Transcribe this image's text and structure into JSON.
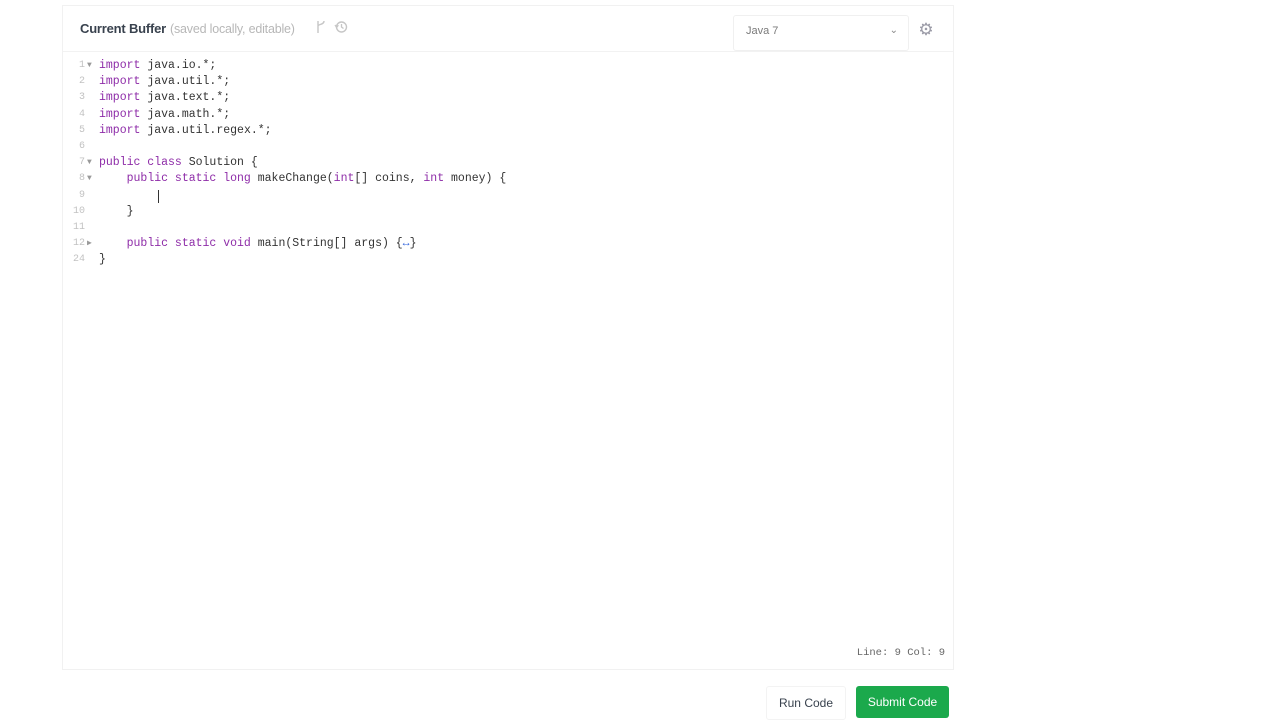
{
  "header": {
    "title": "Current Buffer",
    "subtitle": "(saved locally, editable)",
    "icons": [
      "branch-icon",
      "history-icon"
    ]
  },
  "language_select": {
    "selected": "Java 7"
  },
  "settings_icon": "gear-icon",
  "editor": {
    "lines": [
      {
        "num": "1",
        "fold": "open",
        "indent": "",
        "tokens": [
          {
            "t": "import",
            "kw": true
          },
          {
            "t": " java.io.*;"
          }
        ]
      },
      {
        "num": "2",
        "fold": "",
        "indent": "",
        "tokens": [
          {
            "t": "import",
            "kw": true
          },
          {
            "t": " java.util.*;"
          }
        ]
      },
      {
        "num": "3",
        "fold": "",
        "indent": "",
        "tokens": [
          {
            "t": "import",
            "kw": true
          },
          {
            "t": " java.text.*;"
          }
        ]
      },
      {
        "num": "4",
        "fold": "",
        "indent": "",
        "tokens": [
          {
            "t": "import",
            "kw": true
          },
          {
            "t": " java.math.*;"
          }
        ]
      },
      {
        "num": "5",
        "fold": "",
        "indent": "",
        "tokens": [
          {
            "t": "import",
            "kw": true
          },
          {
            "t": " java.util.regex.*;"
          }
        ]
      },
      {
        "num": "6",
        "fold": "",
        "indent": "",
        "tokens": []
      },
      {
        "num": "7",
        "fold": "open",
        "indent": "",
        "tokens": [
          {
            "t": "public class",
            "kw": true
          },
          {
            "t": " Solution {"
          }
        ]
      },
      {
        "num": "8",
        "fold": "open",
        "indent": "    ",
        "tokens": [
          {
            "t": "public static long",
            "kw": true
          },
          {
            "t": " makeChange("
          },
          {
            "t": "int",
            "kw": true
          },
          {
            "t": "[] coins, "
          },
          {
            "t": "int",
            "kw": true
          },
          {
            "t": " money) {"
          }
        ]
      },
      {
        "num": "9",
        "fold": "",
        "indent": "",
        "tokens": [],
        "cursor": true
      },
      {
        "num": "10",
        "fold": "",
        "indent": "    ",
        "tokens": [
          {
            "t": "}"
          }
        ]
      },
      {
        "num": "11",
        "fold": "",
        "indent": "",
        "tokens": []
      },
      {
        "num": "12",
        "fold": "closed",
        "indent": "    ",
        "tokens": [
          {
            "t": "public static void",
            "kw": true
          },
          {
            "t": " main(String[] args) {"
          },
          {
            "t": "↔",
            "ellipsis": true
          },
          {
            "t": "}"
          }
        ]
      },
      {
        "num": "24",
        "fold": "",
        "indent": "",
        "tokens": [
          {
            "t": "}"
          }
        ]
      }
    ]
  },
  "status": {
    "cursor_position": "Line: 9 Col: 9"
  },
  "actions": {
    "run_label": "Run Code",
    "submit_label": "Submit Code"
  },
  "colors": {
    "keyword": "#8e2ca8",
    "submit_button": "#1ba94c"
  }
}
